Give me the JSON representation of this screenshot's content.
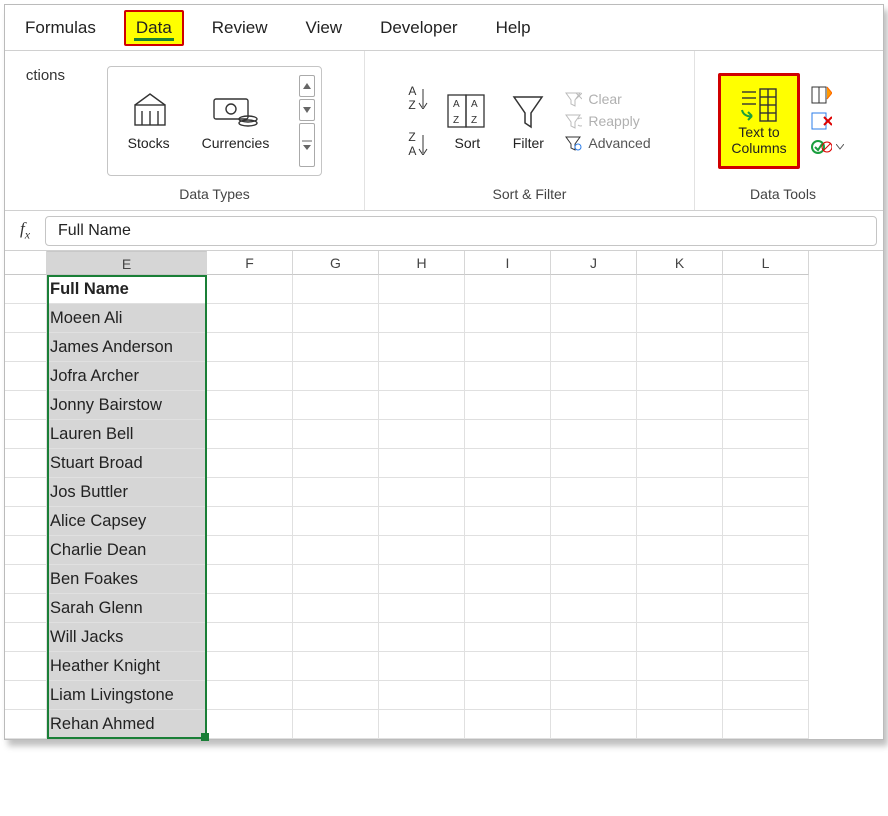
{
  "tabs": {
    "formulas": "Formulas",
    "data": "Data",
    "review": "Review",
    "view": "View",
    "developer": "Developer",
    "help": "Help"
  },
  "ribbon": {
    "stub_text": "ctions",
    "data_types": {
      "stocks": "Stocks",
      "currencies": "Currencies",
      "label": "Data Types"
    },
    "sort_filter": {
      "sort": "Sort",
      "filter": "Filter",
      "clear": "Clear",
      "reapply": "Reapply",
      "advanced": "Advanced",
      "label": "Sort & Filter"
    },
    "data_tools": {
      "text_to_columns_1": "Text to",
      "text_to_columns_2": "Columns",
      "label": "Data Tools"
    }
  },
  "formula_bar": {
    "value": "Full Name"
  },
  "columns": [
    "E",
    "F",
    "G",
    "H",
    "I",
    "J",
    "K",
    "L"
  ],
  "header_cell": "Full Name",
  "rows": [
    "Moeen Ali",
    "James Anderson",
    "Jofra Archer",
    "Jonny Bairstow",
    "Lauren Bell",
    "Stuart Broad",
    "Jos Buttler",
    "Alice Capsey",
    "Charlie Dean",
    "Ben Foakes",
    "Sarah Glenn",
    "Will Jacks",
    "Heather Knight",
    "Liam Livingstone",
    "Rehan Ahmed"
  ]
}
